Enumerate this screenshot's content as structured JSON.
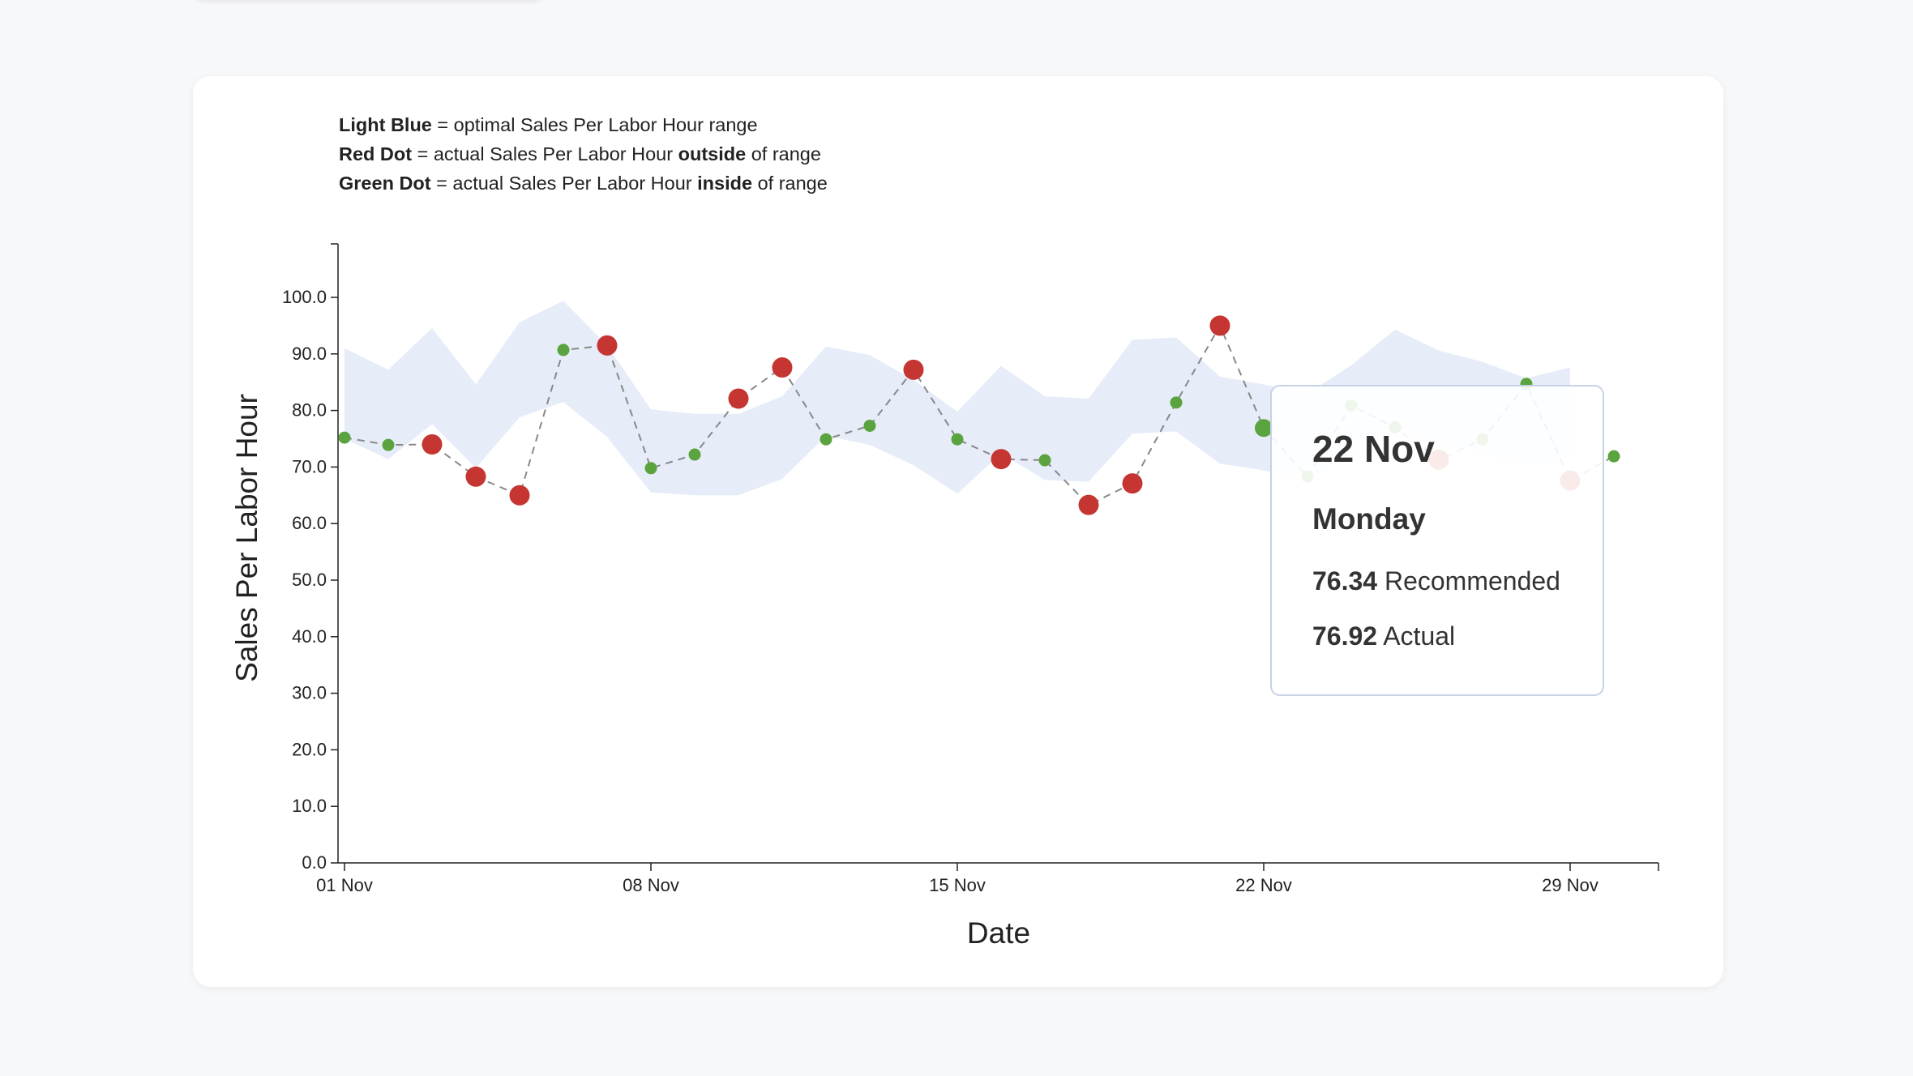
{
  "legend": {
    "line1": {
      "bold": "Light Blue",
      "text": " = optimal Sales Per Labor Hour range"
    },
    "line2": {
      "bold": "Red Dot",
      "text_a": " = actual Sales Per Labor Hour ",
      "bold2": "outside",
      "text_b": " of range"
    },
    "line3": {
      "bold": "Green Dot",
      "text_a": " = actual Sales Per Labor Hour ",
      "bold2": "inside",
      "text_b": " of range"
    }
  },
  "colors": {
    "range_band": "#e6edf8",
    "in_range": "#5aa33f",
    "out_range": "#c53532",
    "line": "#888888"
  },
  "tooltip": {
    "date": "22 Nov",
    "day": "Monday",
    "recommended_value": "76.34",
    "recommended_label": "Recommended",
    "actual_value": "76.92",
    "actual_label": "Actual"
  },
  "chart_data": {
    "type": "line",
    "xlabel": "Date",
    "ylabel": "Sales Per Labor Hour",
    "ylim": [
      0,
      100
    ],
    "y_ticks": [
      "0.0",
      "10.0",
      "20.0",
      "30.0",
      "40.0",
      "50.0",
      "60.0",
      "70.0",
      "80.0",
      "90.0",
      "100.0"
    ],
    "x_ticks": [
      {
        "day": 1,
        "label": "01 Nov"
      },
      {
        "day": 8,
        "label": "08 Nov"
      },
      {
        "day": 15,
        "label": "15 Nov"
      },
      {
        "day": 22,
        "label": "22 Nov"
      },
      {
        "day": 29,
        "label": "29 Nov"
      }
    ],
    "x": [
      1,
      2,
      3,
      4,
      5,
      6,
      7,
      8,
      9,
      10,
      11,
      12,
      13,
      14,
      15,
      16,
      17,
      18,
      19,
      20,
      21,
      22,
      23,
      24,
      25,
      26,
      27,
      28,
      29,
      30
    ],
    "range_upper": [
      91.0,
      87.2,
      94.6,
      84.6,
      95.6,
      99.4,
      91.5,
      80.2,
      79.4,
      79.4,
      82.5,
      91.3,
      89.8,
      85.4,
      79.8,
      87.9,
      82.5,
      82.1,
      92.5,
      92.9,
      86.0,
      84.6,
      83.0,
      88.0,
      94.3,
      90.6,
      88.6,
      85.7,
      87.6
    ],
    "range_lower": [
      75.0,
      71.4,
      77.6,
      69.8,
      78.8,
      81.5,
      75.3,
      65.5,
      65.0,
      65.0,
      67.9,
      75.5,
      73.9,
      70.3,
      65.3,
      72.4,
      67.7,
      67.4,
      75.9,
      76.3,
      70.6,
      69.4,
      68.1,
      72.2,
      77.4,
      74.3,
      72.6,
      70.2,
      71.7
    ],
    "actual": [
      75.2,
      73.9,
      74.0,
      68.3,
      65.0,
      90.7,
      91.5,
      69.8,
      72.2,
      82.1,
      87.6,
      74.9,
      77.3,
      87.2,
      74.9,
      71.4,
      71.2,
      63.3,
      67.1,
      81.4,
      95.0,
      76.9,
      68.3,
      80.9,
      77.0,
      71.3,
      74.9,
      84.7,
      67.6,
      71.9
    ],
    "in_range": [
      true,
      true,
      false,
      false,
      false,
      true,
      false,
      true,
      true,
      false,
      false,
      true,
      true,
      false,
      true,
      false,
      true,
      false,
      false,
      true,
      false,
      true,
      true,
      true,
      true,
      false,
      true,
      true,
      false,
      true
    ]
  }
}
